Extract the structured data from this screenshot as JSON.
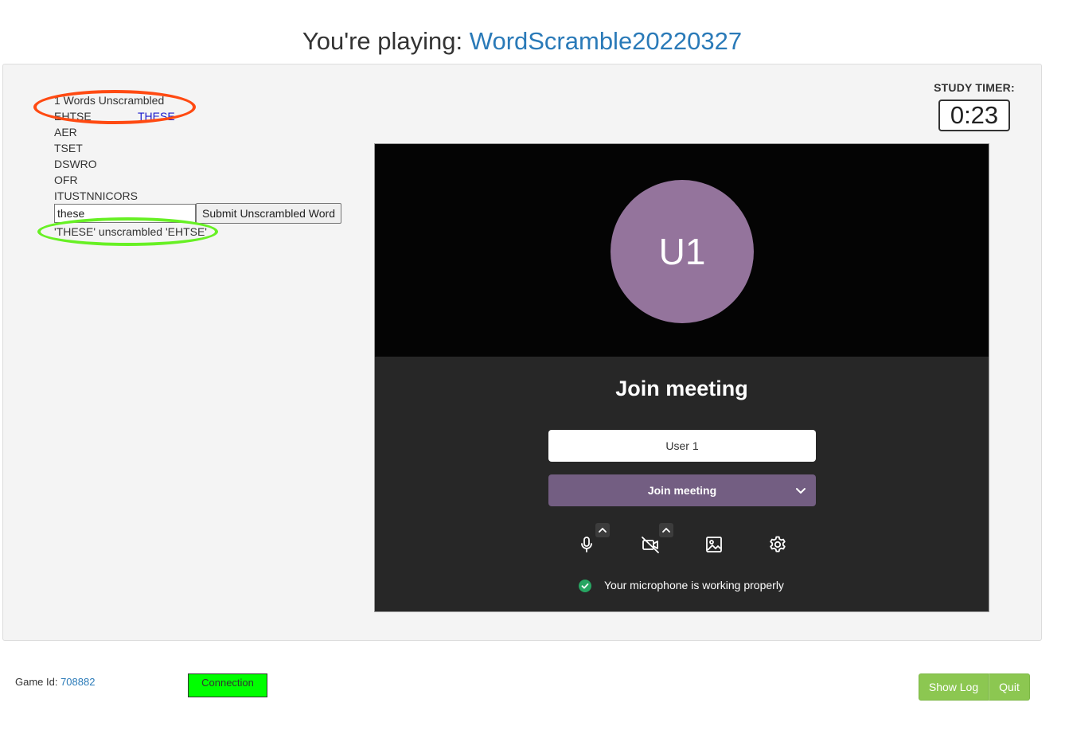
{
  "header": {
    "prefix": "You're playing: ",
    "game_name": "WordScramble20220327"
  },
  "scramble": {
    "count_text": "1 Words Unscrambled",
    "words": [
      {
        "scrambled": "EHTSE",
        "solved": "THESE"
      },
      {
        "scrambled": "AER",
        "solved": ""
      },
      {
        "scrambled": "TSET",
        "solved": ""
      },
      {
        "scrambled": "DSWRO",
        "solved": ""
      },
      {
        "scrambled": "OFR",
        "solved": ""
      },
      {
        "scrambled": "ITUSTNNICORS",
        "solved": ""
      }
    ],
    "input_value": "these",
    "submit_label": "Submit Unscrambled Word",
    "feedback": "'THESE' unscrambled 'EHTSE'"
  },
  "annotations": {
    "red_circle_color": "#ff4a12",
    "green_circle_color": "#67f024"
  },
  "timer": {
    "label": "STUDY TIMER:",
    "value": "0:23"
  },
  "meeting": {
    "avatar_initials": "U1",
    "avatar_color": "#94749c",
    "title": "Join meeting",
    "name_value": "User 1",
    "join_label": "Join meeting",
    "join_color": "#735e82",
    "toolbar_icons": [
      "microphone-icon",
      "video-off-icon",
      "background-image-icon",
      "settings-gear-icon"
    ],
    "mic_status": "Your microphone is working properly",
    "status_color": "#27a562"
  },
  "footer": {
    "game_id_label": "Game Id: ",
    "game_id": "708882",
    "connection_label": "Connection",
    "show_log_label": "Show Log",
    "quit_label": "Quit",
    "button_color": "#8cc751"
  }
}
